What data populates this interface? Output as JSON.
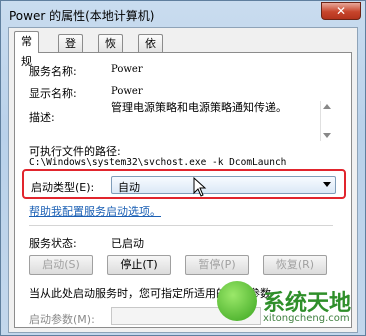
{
  "window": {
    "title": "Power 的属性(本地计算机)",
    "close_label": "✕"
  },
  "tabs": [
    "常规",
    "登录",
    "恢复",
    "依存关系"
  ],
  "general": {
    "service_name_label": "服务名称:",
    "service_name_value": "Power",
    "display_name_label": "显示名称:",
    "display_name_value": "Power",
    "description_label": "描述:",
    "description_value": "管理电源策略和电源策略通知传递。",
    "exec_path_label": "可执行文件的路径:",
    "exec_path_value": "C:\\Windows\\system32\\svchost.exe -k DcomLaunch",
    "startup_type_label": "启动类型(E):",
    "startup_type_value": "自动",
    "help_link": "帮助我配置服务启动选项。",
    "status_label": "服务状态:",
    "status_value": "已启动",
    "buttons": {
      "start": "启动(S)",
      "stop": "停止(T)",
      "pause": "暂停(P)",
      "resume": "恢复(R)"
    },
    "start_params_hint": "当从此处启动服务时，您可指定所适用的启动参数",
    "start_params_label": "启动参数(M):"
  },
  "watermark": {
    "text": "系统天地",
    "url": "xitongcheng.com"
  },
  "colors": {
    "highlight": "#e1252d",
    "link": "#1a5fb4"
  }
}
